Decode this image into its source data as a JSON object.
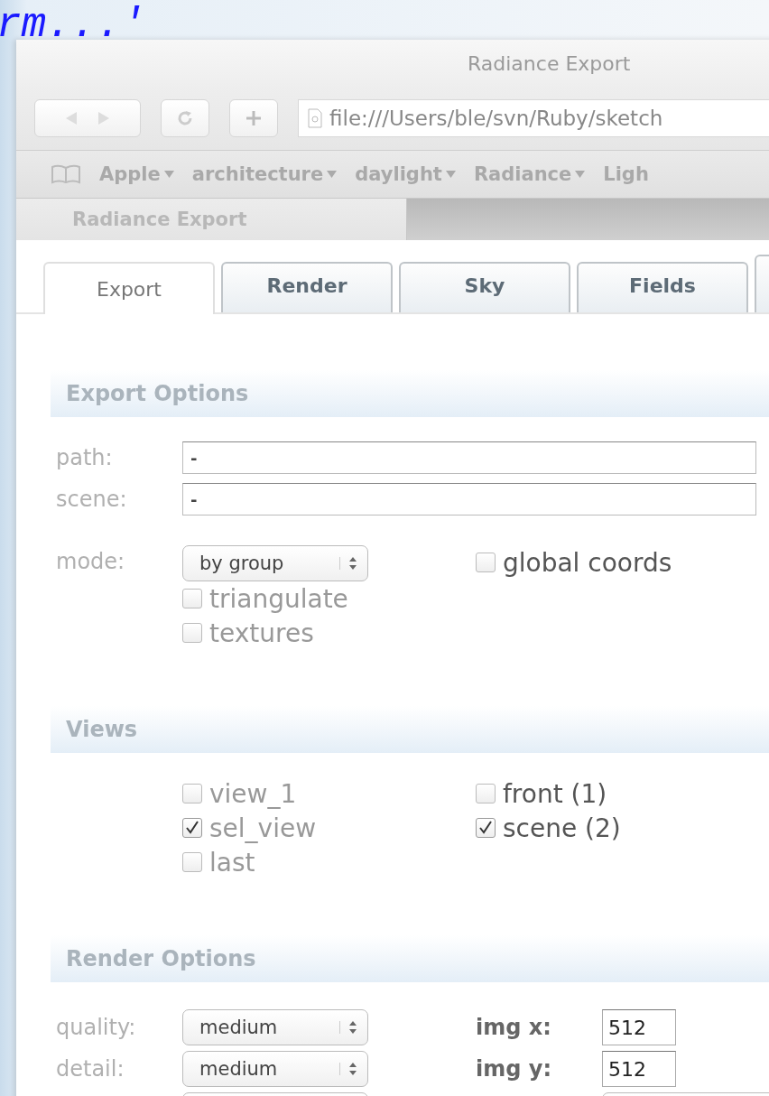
{
  "background_text": "rm...'",
  "window": {
    "title": "Radiance Export"
  },
  "toolbar": {
    "address": "file:///Users/ble/svn/Ruby/sketch"
  },
  "bookmarks": [
    {
      "label": "Apple",
      "menu": true
    },
    {
      "label": "architecture",
      "menu": true
    },
    {
      "label": "daylight",
      "menu": true
    },
    {
      "label": "Radiance",
      "menu": true
    },
    {
      "label": "Ligh",
      "menu": false
    }
  ],
  "browser_tabs": [
    {
      "label": "Radiance Export"
    }
  ],
  "tabs": [
    {
      "label": "Export",
      "selected": true
    },
    {
      "label": "Render",
      "selected": false
    },
    {
      "label": "Sky",
      "selected": false
    },
    {
      "label": "Fields",
      "selected": false
    }
  ],
  "export_options": {
    "title": "Export Options",
    "fields": [
      {
        "label": "path:",
        "value": "-"
      },
      {
        "label": "scene:",
        "value": "-"
      }
    ],
    "mode": {
      "label": "mode:",
      "value": "by group"
    },
    "options": [
      {
        "label": "triangulate",
        "checked": false,
        "disabled": true
      },
      {
        "label": "textures",
        "checked": false,
        "disabled": true
      }
    ],
    "global_coords": {
      "label": "global coords",
      "checked": false,
      "disabled": false
    }
  },
  "views": {
    "title": "Views",
    "columns": [
      [
        {
          "label": "view_1",
          "checked": false,
          "disabled": true
        },
        {
          "label": "sel_view",
          "checked": true,
          "disabled": true
        },
        {
          "label": "last",
          "checked": false,
          "disabled": true
        }
      ],
      [
        {
          "label": "front (1)",
          "checked": false,
          "disabled": false
        },
        {
          "label": "scene (2)",
          "checked": true,
          "disabled": false
        }
      ]
    ]
  },
  "render_options": {
    "title": "Render Options",
    "selects": [
      {
        "label": "quality:",
        "value": "medium"
      },
      {
        "label": "detail:",
        "value": "medium"
      }
    ],
    "sizes": [
      {
        "label": "img x:",
        "value": "512"
      },
      {
        "label": "img y:",
        "value": "512"
      }
    ]
  }
}
